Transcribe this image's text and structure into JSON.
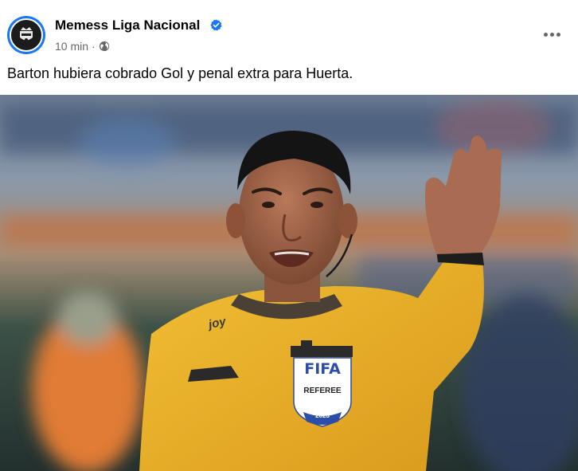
{
  "post": {
    "page_name": "Memess Liga Nacional",
    "time": "10 min",
    "separator": "·",
    "audience_icon": "globe-icon",
    "text": "Barton hubiera cobrado Gol y penal extra para Huerta."
  },
  "photo": {
    "badge_brand": "FIFA",
    "badge_role": "REFEREE",
    "badge_year": "2023",
    "jersey_brand": "joy"
  },
  "colors": {
    "verified": "#1877f2",
    "jersey": "#e9b42a",
    "text_primary": "#050505",
    "text_secondary": "#65676b"
  }
}
